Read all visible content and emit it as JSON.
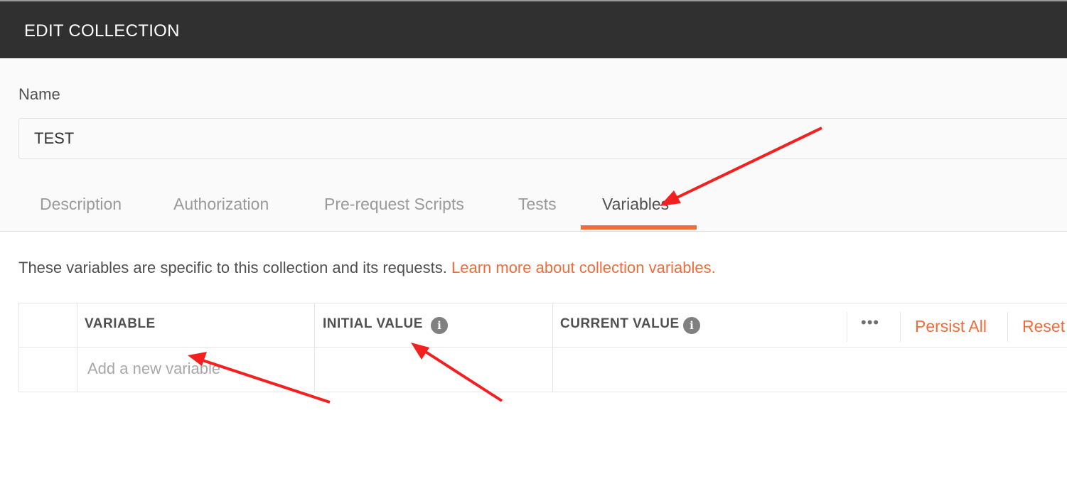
{
  "header": {
    "title": "EDIT COLLECTION"
  },
  "name_field": {
    "label": "Name",
    "value": "TEST"
  },
  "tabs": [
    {
      "label": "Description",
      "active": false
    },
    {
      "label": "Authorization",
      "active": false
    },
    {
      "label": "Pre-request Scripts",
      "active": false
    },
    {
      "label": "Tests",
      "active": false
    },
    {
      "label": "Variables",
      "active": true
    }
  ],
  "variables": {
    "info_text": "These variables are specific to this collection and its requests.",
    "info_link": "Learn more about collection variables.",
    "columns": {
      "variable": "VARIABLE",
      "initial_value": "INITIAL VALUE",
      "current_value": "CURRENT VALUE"
    },
    "info_icon_glyph": "i",
    "more_glyph": "•••",
    "persist_all": "Persist All",
    "reset": "Reset",
    "new_variable_placeholder": "Add a new variable"
  },
  "icons": {
    "info": "info-icon",
    "more": "more-options-icon"
  },
  "colors": {
    "accent": "#f26b3a",
    "header_bg": "#303030",
    "annotation_arrow": "#f42020"
  }
}
